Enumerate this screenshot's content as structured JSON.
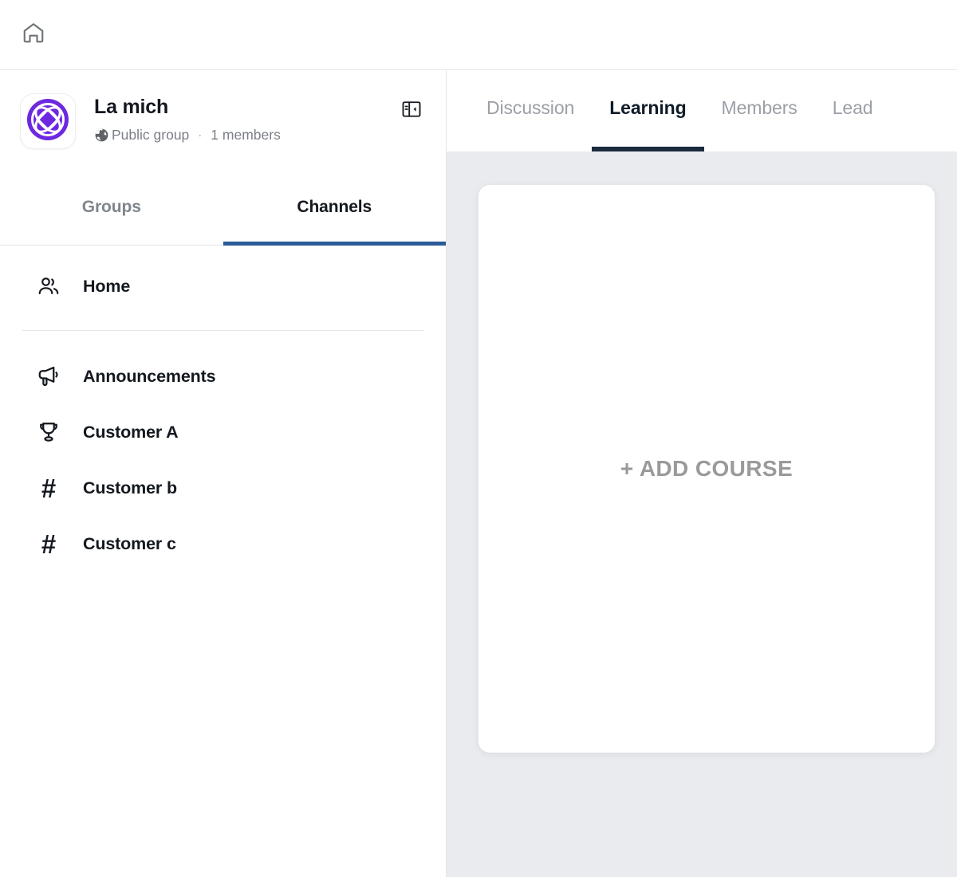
{
  "topbar": {
    "home_icon": "home-icon"
  },
  "sidebar": {
    "group": {
      "name": "La mich",
      "avatar_icon": "group-avatar-logo",
      "avatar_color": "#6d28e0",
      "privacy_icon": "globe-icon",
      "privacy": "Public group",
      "separator": "·",
      "members": "1 members",
      "collapse_icon": "collapse-panel-icon"
    },
    "tabs": [
      {
        "label": "Groups",
        "active": false
      },
      {
        "label": "Channels",
        "active": true
      }
    ],
    "tab_active_color": "#2a5b98",
    "channels_primary": [
      {
        "label": "Home",
        "icon": "users-icon"
      }
    ],
    "channels": [
      {
        "label": "Announcements",
        "icon": "megaphone-icon"
      },
      {
        "label": "Customer A",
        "icon": "trophy-icon"
      },
      {
        "label": "Customer b",
        "icon": "hash-icon"
      },
      {
        "label": "Customer c",
        "icon": "hash-icon"
      }
    ]
  },
  "main": {
    "tabs": [
      {
        "label": "Discussion",
        "active": false
      },
      {
        "label": "Learning",
        "active": true
      },
      {
        "label": "Members",
        "active": false
      },
      {
        "label": "Lead",
        "active": false
      }
    ],
    "tab_active_color": "#1b2a3d",
    "add_course_label": "+ ADD COURSE",
    "background_color": "#e9ebee"
  }
}
